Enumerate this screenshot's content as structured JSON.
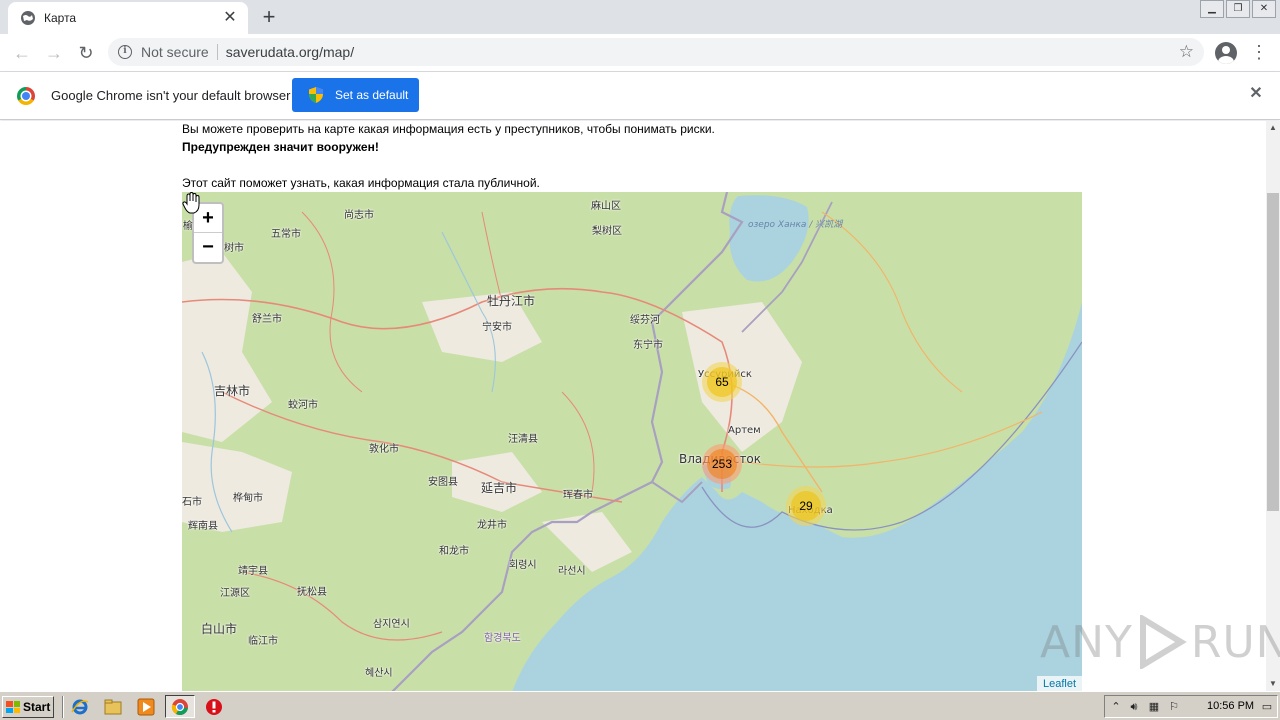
{
  "browser": {
    "tab": {
      "title": "Карта"
    },
    "address": {
      "security_label": "Not secure",
      "url": "saverudata.org/map/"
    }
  },
  "infobar": {
    "message": "Google Chrome isn't your default browser",
    "button_label": "Set as default"
  },
  "content": {
    "line1": "Вы можете проверить на карте какая информация есть у преступников, чтобы понимать риски.",
    "line2": "Предупрежден значит вооружен!",
    "line3": "Этот сайт поможет узнать, какая информация стала публичной."
  },
  "map": {
    "zoom_in": "+",
    "zoom_out": "−",
    "attribution": "Leaflet",
    "clusters": [
      {
        "count": "65",
        "level": "medium"
      },
      {
        "count": "253",
        "level": "large"
      },
      {
        "count": "29",
        "level": "medium"
      }
    ],
    "labels": {
      "shangzhi": "尚志市",
      "mashan": "麻山区",
      "lishu": "梨树区",
      "wuchang": "五常市",
      "shu": "树市",
      "yu": "榆",
      "mudanjiang": "牡丹江市",
      "suifenhe": "绥芬河",
      "ningan": "宁安市",
      "shulan": "舒兰市",
      "dongning": "东宁市",
      "jilin": "吉林市",
      "jiaohe": "蛟河市",
      "ussuriysk": "Уссурийск",
      "artem": "Артем",
      "wangqing": "汪清县",
      "dunhua": "敦化市",
      "vladivostok": "Владивосток",
      "antu": "安图县",
      "yanji": "延吉市",
      "hunchun": "珲春市",
      "nakhodka": "Находка",
      "shi": "石市",
      "huadian": "桦甸市",
      "longjing": "龙井市",
      "huinan": "辉南县",
      "helong": "和龙市",
      "hoeryong": "회령시",
      "rason": "라선시",
      "jingyu": "靖宇县",
      "fusong": "抚松县",
      "jiangyuan": "江源区",
      "baishan": "白山市",
      "linjiang": "临江市",
      "samjiyon": "삼지연시",
      "hamgyongbuk": "함경북도",
      "hyesan": "혜산시",
      "lake": "озеро Ханка / 兴凯湖"
    }
  },
  "taskbar": {
    "start_label": "Start",
    "clock": "10:56 PM"
  },
  "watermark": {
    "left": "ANY",
    "right": "RUN"
  },
  "colors": {
    "accent": "#1a73e8",
    "map_land": "#c9dfa8",
    "map_water": "#aad3df",
    "cluster_medium": "#f0c20c",
    "cluster_large": "#f18017"
  }
}
